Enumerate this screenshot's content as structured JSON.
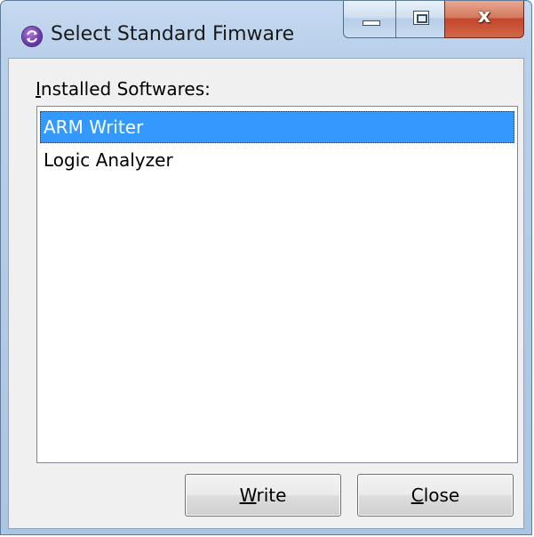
{
  "window": {
    "title": "Select Standard Fimware",
    "icon": "app-refresh-icon",
    "caption": {
      "minimize_icon": "minimize-icon",
      "maximize_icon": "maximize-icon",
      "close_glyph": "x"
    }
  },
  "list": {
    "label": "Installed Softwares:",
    "label_first": "I",
    "label_rest": "nstalled Softwares:",
    "items": [
      {
        "label": "ARM Writer",
        "selected": true
      },
      {
        "label": "Logic Analyzer",
        "selected": false
      }
    ]
  },
  "buttons": {
    "write_label": "Write",
    "write_first": "W",
    "write_rest": "rite",
    "close_label": "Close",
    "close_first": "C",
    "close_rest": "lose"
  },
  "colors": {
    "selection": "#3399ff",
    "titlebar": "#b9d0ea",
    "close_button": "#c2462a"
  }
}
